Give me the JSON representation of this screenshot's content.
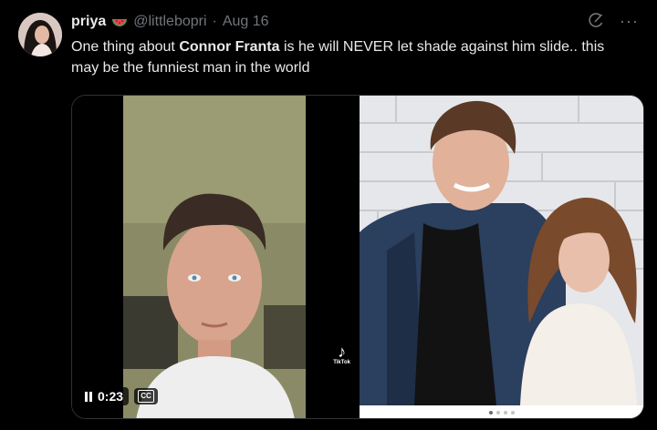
{
  "author": {
    "display_name": "priya",
    "handle": "@littlebopri",
    "separator": "·",
    "date": "Aug 16",
    "name_emoji_icon": "watermelon-icon"
  },
  "tweet": {
    "text_part1": "One thing about ",
    "text_bold": "Connor Franta",
    "text_part2": " is he will NEVER let shade against him slide.. this may be the funniest man in the world"
  },
  "media": {
    "video": {
      "time": "0:23",
      "cc_label": "CC",
      "watermark_logo": "♪",
      "watermark_label": "TikTok"
    },
    "carousel_dots": 4,
    "active_dot": 0
  },
  "icons": {
    "grok": "grok-icon",
    "more": "more-icon",
    "pause": "pause-icon",
    "captions": "captions-icon"
  },
  "colors": {
    "background": "#000000",
    "text": "#e7e9ea",
    "muted": "#71767b",
    "border": "#2f3336"
  }
}
